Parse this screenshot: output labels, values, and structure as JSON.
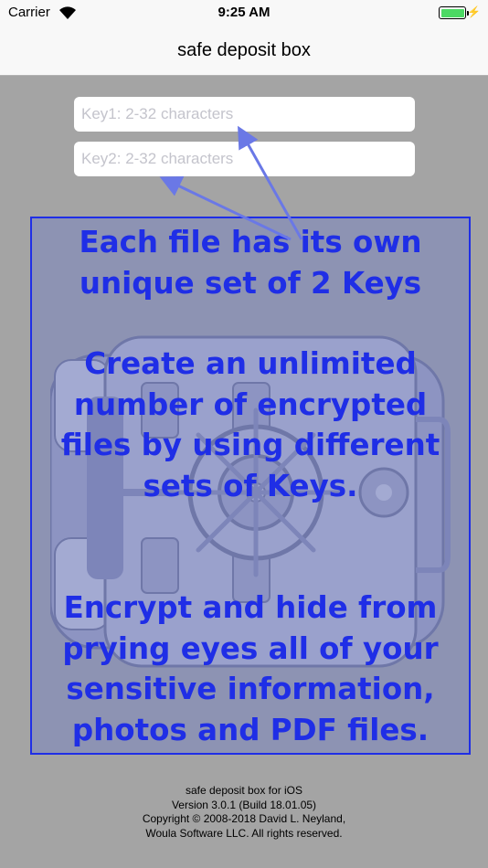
{
  "status_bar": {
    "carrier": "Carrier",
    "time": "9:25 AM"
  },
  "nav": {
    "title": "safe deposit box"
  },
  "fields": {
    "key1_placeholder": "Key1: 2-32 characters",
    "key2_placeholder": "Key2: 2-32 characters"
  },
  "overlay": {
    "line1": "Each file has its own",
    "line2": "unique set of 2 Keys",
    "line3": "Create an unlimited",
    "line4": "number of encrypted",
    "line5": "files by using different",
    "line6": "sets of Keys.",
    "line7": "Encrypt and hide from",
    "line8": "prying eyes all of your",
    "line9": "sensitive information,",
    "line10": "photos and PDF files."
  },
  "footer": {
    "line1": "safe deposit box for iOS",
    "line2": "Version 3.0.1 (Build 18.01.05)",
    "line3": "Copyright © 2008-2018 David L. Neyland,",
    "line4": "Woula Software LLC. All rights reserved."
  },
  "colors": {
    "accent": "#1f2ee6",
    "background": "#a4a4a4",
    "bar": "#f8f8f8",
    "battery": "#4cd964"
  },
  "icons": [
    "wifi-icon",
    "battery-icon",
    "charging-bolt-icon",
    "vault-door-icon"
  ]
}
